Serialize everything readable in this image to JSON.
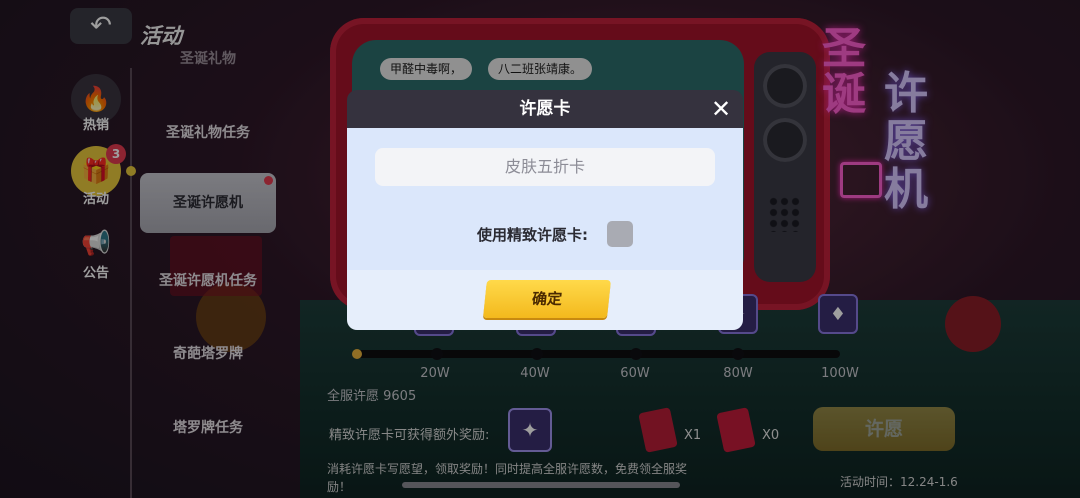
{
  "topbar": {
    "back_icon": "back-arrow-icon",
    "title": "活动"
  },
  "nav": {
    "items": [
      {
        "icon": "fire-icon",
        "label": "热销"
      },
      {
        "icon": "gift-icon",
        "label": "活动",
        "badge": "3"
      },
      {
        "icon": "notice-icon",
        "label": "公告"
      }
    ]
  },
  "submenu": {
    "items": [
      "圣诞礼物",
      "圣诞礼物任务",
      "圣诞许愿机",
      "圣诞许愿机任务",
      "奇葩塔罗牌",
      "塔罗牌任务"
    ],
    "active_index": 2
  },
  "scene": {
    "ticker_items": [
      "甲醛中毒啊，",
      "八二班张靖康。"
    ],
    "neon_title_a": "圣诞",
    "neon_title_b": "许愿机"
  },
  "progress": {
    "milestones": [
      "20W",
      "40W",
      "60W",
      "80W",
      "100W"
    ],
    "server_label": "全服许愿 9605",
    "extra_label": "精致许愿卡可获得额外奖励:",
    "count_a": "X1",
    "count_b": "X0",
    "wish_button": "许愿",
    "note": "消耗许愿卡写愿望，领取奖励！同时提高全服许愿数，免费领全服奖励！",
    "timer": "活动时间：12.24-1.6"
  },
  "modal": {
    "title": "许愿卡",
    "close_icon": "close-icon",
    "field_value": "皮肤五折卡",
    "use_label": "使用精致许愿卡:",
    "use_checked": false,
    "confirm_label": "确定"
  }
}
